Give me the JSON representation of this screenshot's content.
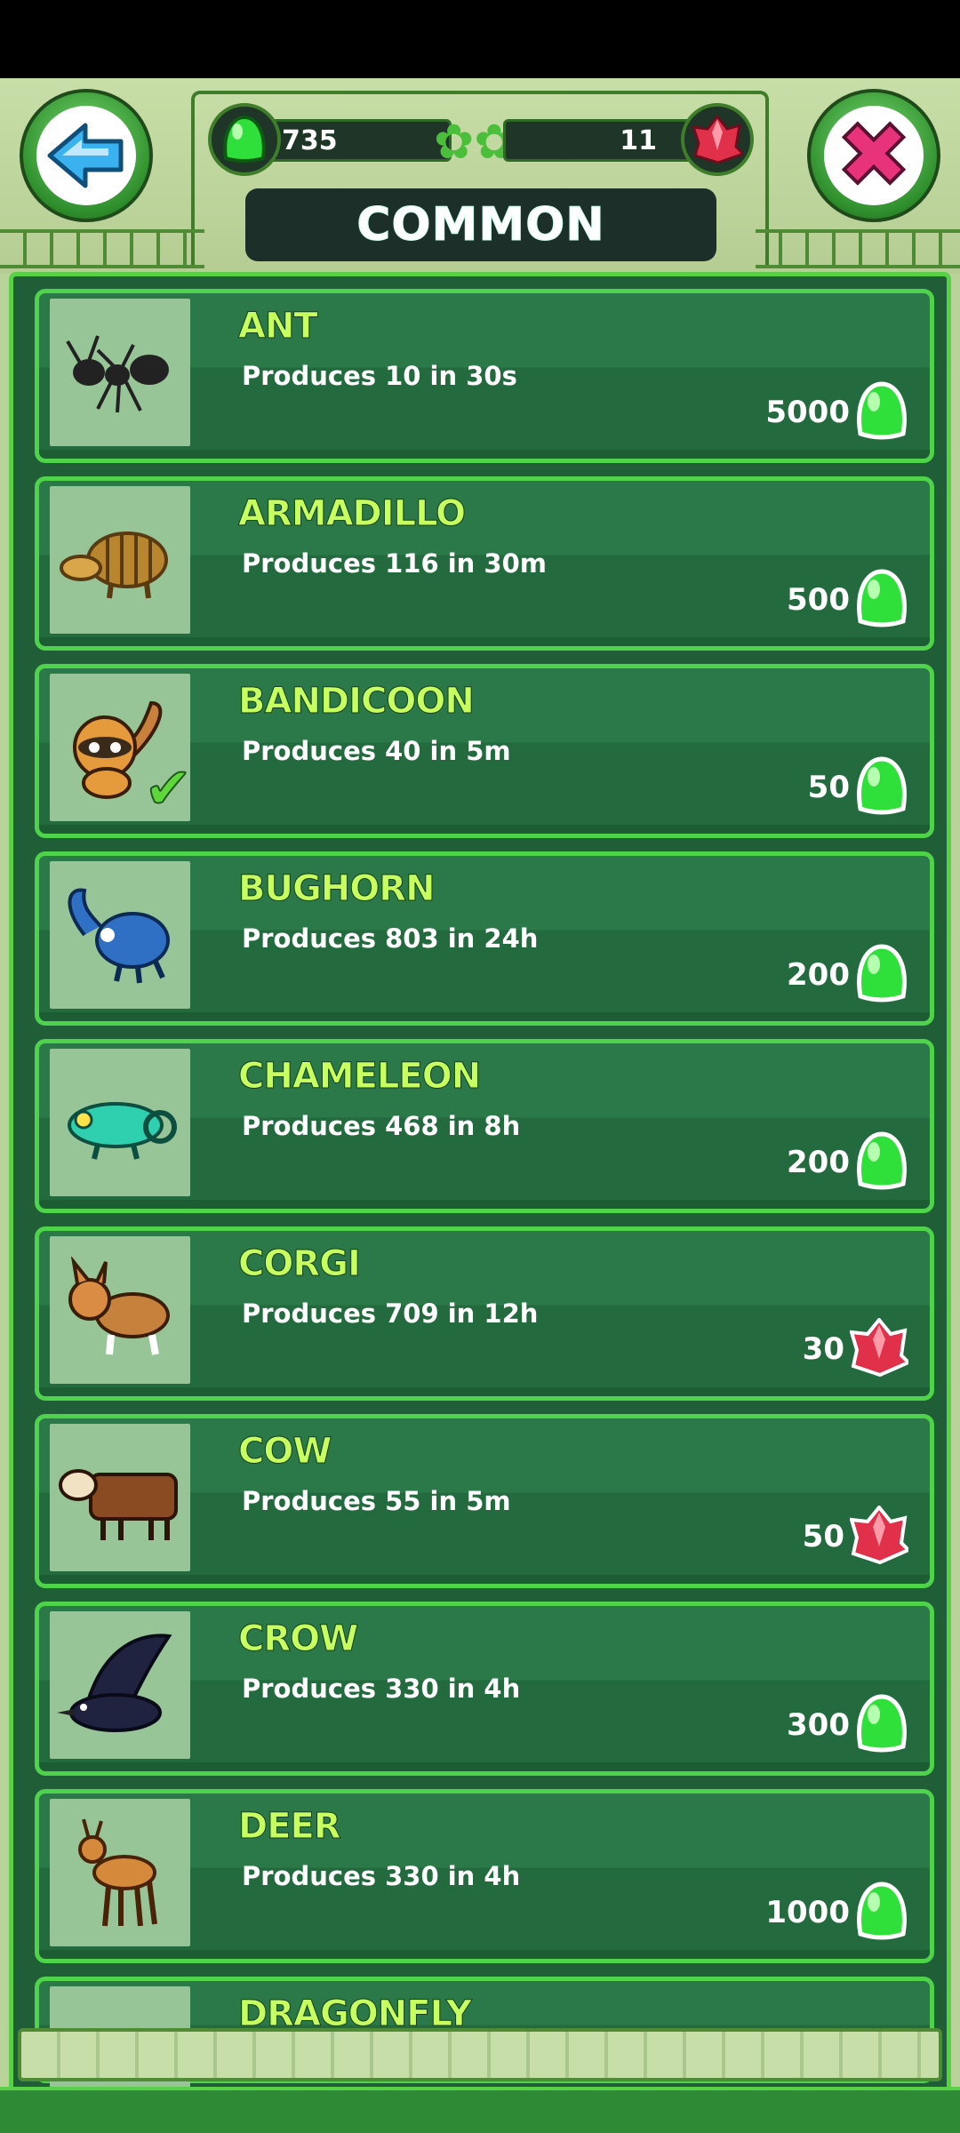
{
  "header": {
    "title": "COMMON",
    "jelly_count": "735",
    "gem_count": "11"
  },
  "icons": {
    "back": "back-arrow-icon",
    "close": "close-x-icon",
    "jelly": "green-jelly-icon",
    "gem": "red-gem-icon"
  },
  "colors": {
    "name": "#c6ff5e",
    "card_border": "#4fd34a",
    "jelly": "#2fe03a",
    "gem": "#e0304a"
  },
  "creatures": [
    {
      "name": "ANT",
      "desc": "Produces 10 in 30s",
      "price": "5000",
      "currency": "jelly",
      "owned": false
    },
    {
      "name": "ARMADILLO",
      "desc": "Produces 116 in 30m",
      "price": "500",
      "currency": "jelly",
      "owned": false
    },
    {
      "name": "BANDICOON",
      "desc": "Produces 40 in 5m",
      "price": "50",
      "currency": "jelly",
      "owned": true
    },
    {
      "name": "BUGHORN",
      "desc": "Produces 803 in 24h",
      "price": "200",
      "currency": "jelly",
      "owned": false
    },
    {
      "name": "CHAMELEON",
      "desc": "Produces 468 in 8h",
      "price": "200",
      "currency": "jelly",
      "owned": false
    },
    {
      "name": "CORGI",
      "desc": "Produces 709 in 12h",
      "price": "30",
      "currency": "gem",
      "owned": false
    },
    {
      "name": "COW",
      "desc": "Produces 55 in 5m",
      "price": "50",
      "currency": "gem",
      "owned": false
    },
    {
      "name": "CROW",
      "desc": "Produces 330 in 4h",
      "price": "300",
      "currency": "jelly",
      "owned": false
    },
    {
      "name": "DEER",
      "desc": "Produces 330 in 4h",
      "price": "1000",
      "currency": "jelly",
      "owned": false
    },
    {
      "name": "DRAGONFLY",
      "desc": "",
      "price": "",
      "currency": "",
      "owned": false
    }
  ]
}
